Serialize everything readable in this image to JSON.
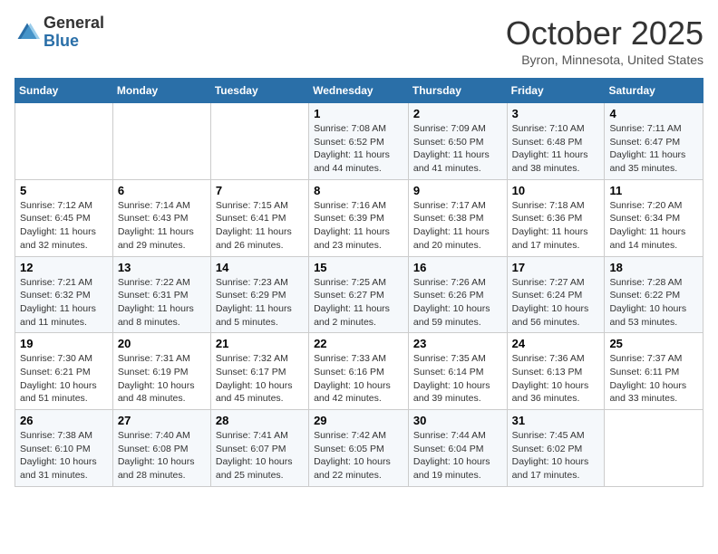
{
  "header": {
    "logo_general": "General",
    "logo_blue": "Blue",
    "month": "October 2025",
    "location": "Byron, Minnesota, United States"
  },
  "days_of_week": [
    "Sunday",
    "Monday",
    "Tuesday",
    "Wednesday",
    "Thursday",
    "Friday",
    "Saturday"
  ],
  "weeks": [
    [
      {
        "day": "",
        "info": ""
      },
      {
        "day": "",
        "info": ""
      },
      {
        "day": "",
        "info": ""
      },
      {
        "day": "1",
        "info": "Sunrise: 7:08 AM\nSunset: 6:52 PM\nDaylight: 11 hours and 44 minutes."
      },
      {
        "day": "2",
        "info": "Sunrise: 7:09 AM\nSunset: 6:50 PM\nDaylight: 11 hours and 41 minutes."
      },
      {
        "day": "3",
        "info": "Sunrise: 7:10 AM\nSunset: 6:48 PM\nDaylight: 11 hours and 38 minutes."
      },
      {
        "day": "4",
        "info": "Sunrise: 7:11 AM\nSunset: 6:47 PM\nDaylight: 11 hours and 35 minutes."
      }
    ],
    [
      {
        "day": "5",
        "info": "Sunrise: 7:12 AM\nSunset: 6:45 PM\nDaylight: 11 hours and 32 minutes."
      },
      {
        "day": "6",
        "info": "Sunrise: 7:14 AM\nSunset: 6:43 PM\nDaylight: 11 hours and 29 minutes."
      },
      {
        "day": "7",
        "info": "Sunrise: 7:15 AM\nSunset: 6:41 PM\nDaylight: 11 hours and 26 minutes."
      },
      {
        "day": "8",
        "info": "Sunrise: 7:16 AM\nSunset: 6:39 PM\nDaylight: 11 hours and 23 minutes."
      },
      {
        "day": "9",
        "info": "Sunrise: 7:17 AM\nSunset: 6:38 PM\nDaylight: 11 hours and 20 minutes."
      },
      {
        "day": "10",
        "info": "Sunrise: 7:18 AM\nSunset: 6:36 PM\nDaylight: 11 hours and 17 minutes."
      },
      {
        "day": "11",
        "info": "Sunrise: 7:20 AM\nSunset: 6:34 PM\nDaylight: 11 hours and 14 minutes."
      }
    ],
    [
      {
        "day": "12",
        "info": "Sunrise: 7:21 AM\nSunset: 6:32 PM\nDaylight: 11 hours and 11 minutes."
      },
      {
        "day": "13",
        "info": "Sunrise: 7:22 AM\nSunset: 6:31 PM\nDaylight: 11 hours and 8 minutes."
      },
      {
        "day": "14",
        "info": "Sunrise: 7:23 AM\nSunset: 6:29 PM\nDaylight: 11 hours and 5 minutes."
      },
      {
        "day": "15",
        "info": "Sunrise: 7:25 AM\nSunset: 6:27 PM\nDaylight: 11 hours and 2 minutes."
      },
      {
        "day": "16",
        "info": "Sunrise: 7:26 AM\nSunset: 6:26 PM\nDaylight: 10 hours and 59 minutes."
      },
      {
        "day": "17",
        "info": "Sunrise: 7:27 AM\nSunset: 6:24 PM\nDaylight: 10 hours and 56 minutes."
      },
      {
        "day": "18",
        "info": "Sunrise: 7:28 AM\nSunset: 6:22 PM\nDaylight: 10 hours and 53 minutes."
      }
    ],
    [
      {
        "day": "19",
        "info": "Sunrise: 7:30 AM\nSunset: 6:21 PM\nDaylight: 10 hours and 51 minutes."
      },
      {
        "day": "20",
        "info": "Sunrise: 7:31 AM\nSunset: 6:19 PM\nDaylight: 10 hours and 48 minutes."
      },
      {
        "day": "21",
        "info": "Sunrise: 7:32 AM\nSunset: 6:17 PM\nDaylight: 10 hours and 45 minutes."
      },
      {
        "day": "22",
        "info": "Sunrise: 7:33 AM\nSunset: 6:16 PM\nDaylight: 10 hours and 42 minutes."
      },
      {
        "day": "23",
        "info": "Sunrise: 7:35 AM\nSunset: 6:14 PM\nDaylight: 10 hours and 39 minutes."
      },
      {
        "day": "24",
        "info": "Sunrise: 7:36 AM\nSunset: 6:13 PM\nDaylight: 10 hours and 36 minutes."
      },
      {
        "day": "25",
        "info": "Sunrise: 7:37 AM\nSunset: 6:11 PM\nDaylight: 10 hours and 33 minutes."
      }
    ],
    [
      {
        "day": "26",
        "info": "Sunrise: 7:38 AM\nSunset: 6:10 PM\nDaylight: 10 hours and 31 minutes."
      },
      {
        "day": "27",
        "info": "Sunrise: 7:40 AM\nSunset: 6:08 PM\nDaylight: 10 hours and 28 minutes."
      },
      {
        "day": "28",
        "info": "Sunrise: 7:41 AM\nSunset: 6:07 PM\nDaylight: 10 hours and 25 minutes."
      },
      {
        "day": "29",
        "info": "Sunrise: 7:42 AM\nSunset: 6:05 PM\nDaylight: 10 hours and 22 minutes."
      },
      {
        "day": "30",
        "info": "Sunrise: 7:44 AM\nSunset: 6:04 PM\nDaylight: 10 hours and 19 minutes."
      },
      {
        "day": "31",
        "info": "Sunrise: 7:45 AM\nSunset: 6:02 PM\nDaylight: 10 hours and 17 minutes."
      },
      {
        "day": "",
        "info": ""
      }
    ]
  ]
}
